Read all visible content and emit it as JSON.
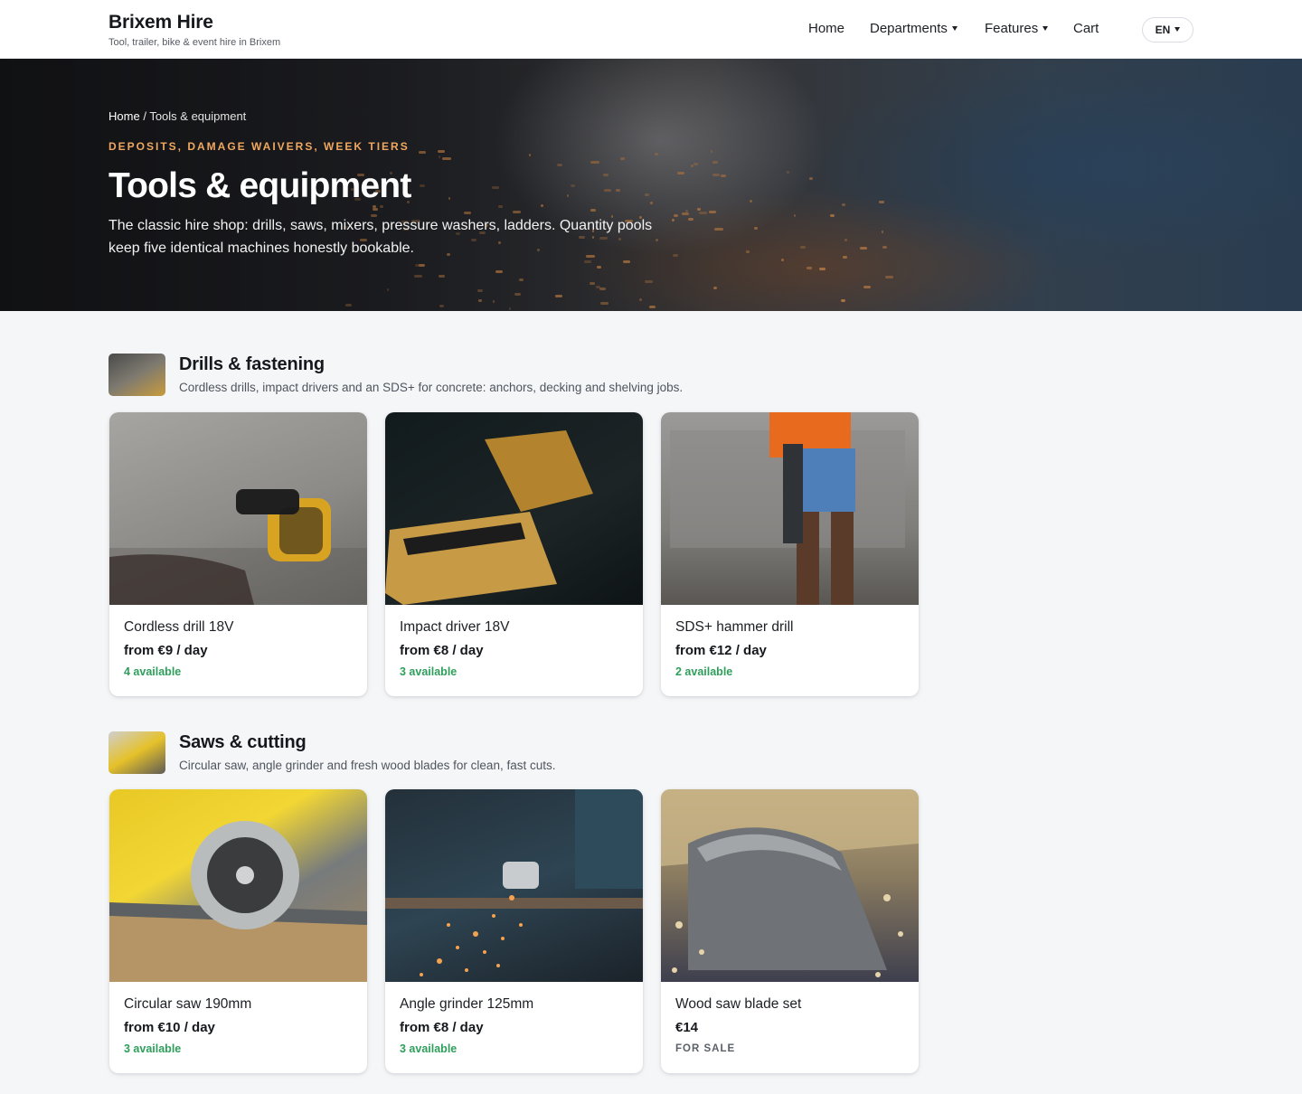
{
  "header": {
    "brand_name": "Brixem Hire",
    "brand_tagline": "Tool, trailer, bike & event hire in Brixem",
    "nav": [
      {
        "label": "Home",
        "has_caret": false
      },
      {
        "label": "Departments",
        "has_caret": true
      },
      {
        "label": "Features",
        "has_caret": true
      },
      {
        "label": "Cart",
        "has_caret": false
      }
    ],
    "language": "EN"
  },
  "hero": {
    "breadcrumb_home": "Home",
    "breadcrumb_sep": "/",
    "breadcrumb_current": "Tools & equipment",
    "eyebrow": "DEPOSITS, DAMAGE WAIVERS, WEEK TIERS",
    "title": "Tools & equipment",
    "subtitle": "The classic hire shop: drills, saws, mixers, pressure washers, ladders. Quantity pools keep five identical machines honestly bookable."
  },
  "sections": [
    {
      "title": "Drills & fastening",
      "description": "Cordless drills, impact drivers and an SDS+ for concrete: anchors, decking and shelving jobs.",
      "items": [
        {
          "name": "Cordless drill 18V",
          "price": "from €9 / day",
          "status": "4 available"
        },
        {
          "name": "Impact driver 18V",
          "price": "from €8 / day",
          "status": "3 available"
        },
        {
          "name": "SDS+ hammer drill",
          "price": "from €12 / day",
          "status": "2 available"
        }
      ]
    },
    {
      "title": "Saws & cutting",
      "description": "Circular saw, angle grinder and fresh wood blades for clean, fast cuts.",
      "items": [
        {
          "name": "Circular saw 190mm",
          "price": "from €10 / day",
          "status": "3 available"
        },
        {
          "name": "Angle grinder 125mm",
          "price": "from €8 / day",
          "status": "3 available"
        },
        {
          "name": "Wood saw blade set",
          "price": "€14",
          "status": "FOR SALE"
        }
      ]
    }
  ],
  "colors": {
    "accent_orange": "#f0a860",
    "available_green": "#2e9e5b",
    "page_background": "#f5f6f8"
  },
  "icons": [
    "chevron-down-icon"
  ]
}
